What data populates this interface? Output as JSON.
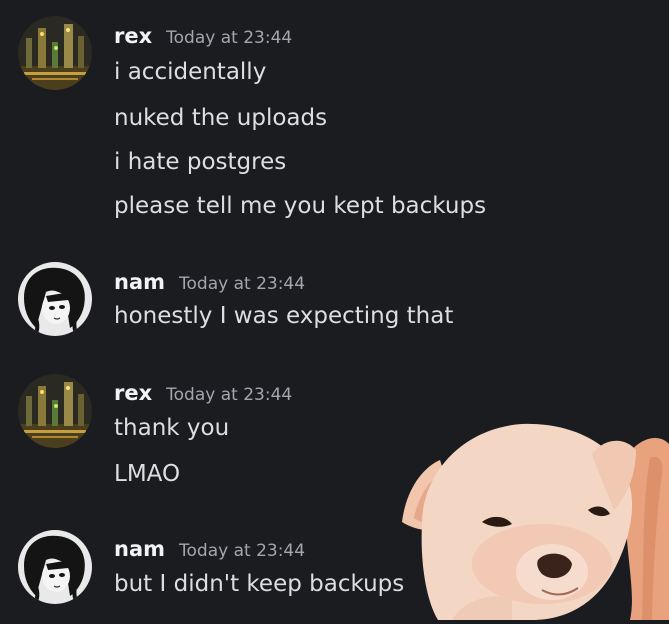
{
  "messages": [
    {
      "author": "rex",
      "timestamp": "Today at 23:44",
      "avatar_icon": "city-night-avatar-icon",
      "lines": [
        "i accidentally",
        "nuked the uploads",
        "i hate postgres",
        "please tell me you kept backups"
      ]
    },
    {
      "author": "nam",
      "timestamp": "Today at 23:44",
      "avatar_icon": "anime-girl-avatar-icon",
      "lines": [
        "honestly I was expecting that"
      ]
    },
    {
      "author": "rex",
      "timestamp": "Today at 23:44",
      "avatar_icon": "city-night-avatar-icon",
      "lines": [
        "thank you",
        "LMAO"
      ]
    },
    {
      "author": "nam",
      "timestamp": "Today at 23:44",
      "avatar_icon": "anime-girl-avatar-icon",
      "lines": [
        "but I didn't keep backups"
      ]
    }
  ],
  "sticker": {
    "icon": "chihuahua-sticker-icon"
  },
  "colors": {
    "background": "#1b1c1f",
    "username": "#f2f3f5",
    "timestamp": "#a3a6ad",
    "message_text": "#dcdee1"
  }
}
